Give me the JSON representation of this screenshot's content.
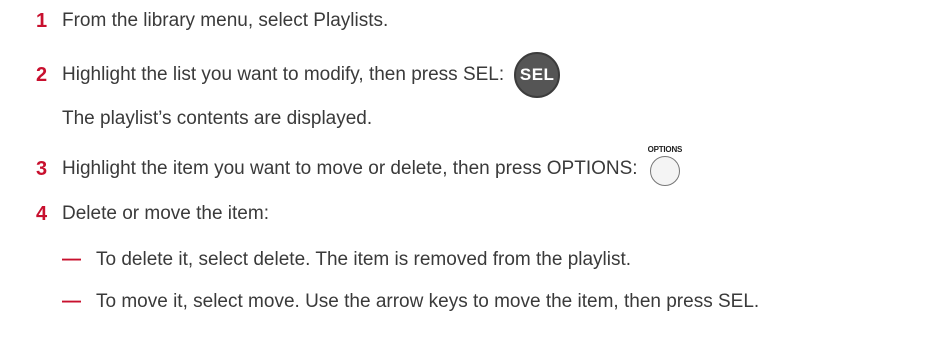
{
  "steps": [
    {
      "number": "1",
      "text": "From the library menu, select Playlists."
    },
    {
      "number": "2",
      "text": "Highlight the list you want to modify, then press SEL:",
      "button_label": "SEL",
      "note": "The playlist’s contents are displayed."
    },
    {
      "number": "3",
      "text": "Highlight the item you want to move or delete, then press OPTIONS:",
      "button_label": "OPTIONS"
    },
    {
      "number": "4",
      "text": "Delete or move the item:"
    }
  ],
  "bullets": [
    {
      "marker": "—",
      "text": "To delete it, select delete. The item is removed from the playlist."
    },
    {
      "marker": "—",
      "text": "To move it, select move. Use the arrow keys to move the item, then press SEL."
    }
  ],
  "colors": {
    "accent": "#c8102e",
    "text": "#3a3a3a",
    "sel_button": "#555555"
  }
}
